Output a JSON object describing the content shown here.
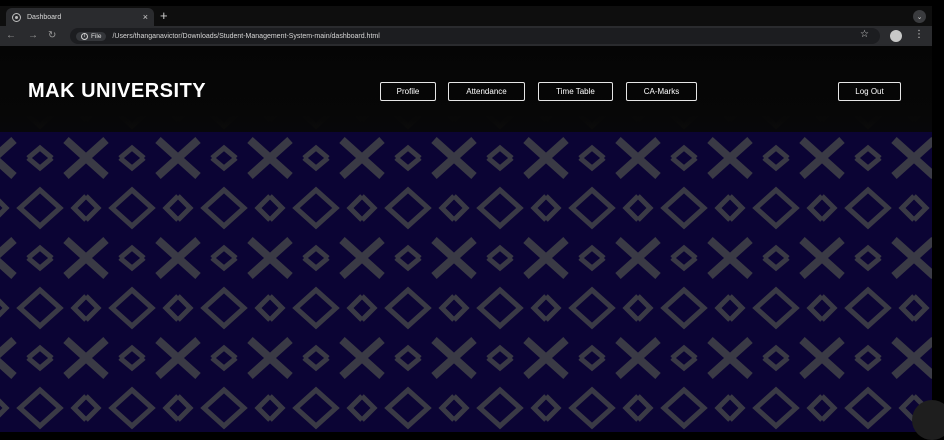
{
  "browser": {
    "tab_title": "Dashboard",
    "tab_close": "×",
    "new_tab": "+",
    "tab_menu": "⌄",
    "back": "←",
    "forward": "→",
    "reload": "↻",
    "chip_label": "File",
    "url": "/Users/thanganavictor/Downloads/Student-Management-System-main/dashboard.html",
    "bookmark": "☆",
    "menu": "⋮"
  },
  "site": {
    "brand": "MAK UNIVERSITY",
    "nav": {
      "profile": "Profile",
      "attendance": "Attendance",
      "timetable": "Time Table",
      "camarks": "CA-Marks"
    },
    "logout": "Log Out"
  },
  "colors": {
    "background": "#0b0434",
    "pattern": "#3a3a45",
    "navbar": "#050505"
  }
}
